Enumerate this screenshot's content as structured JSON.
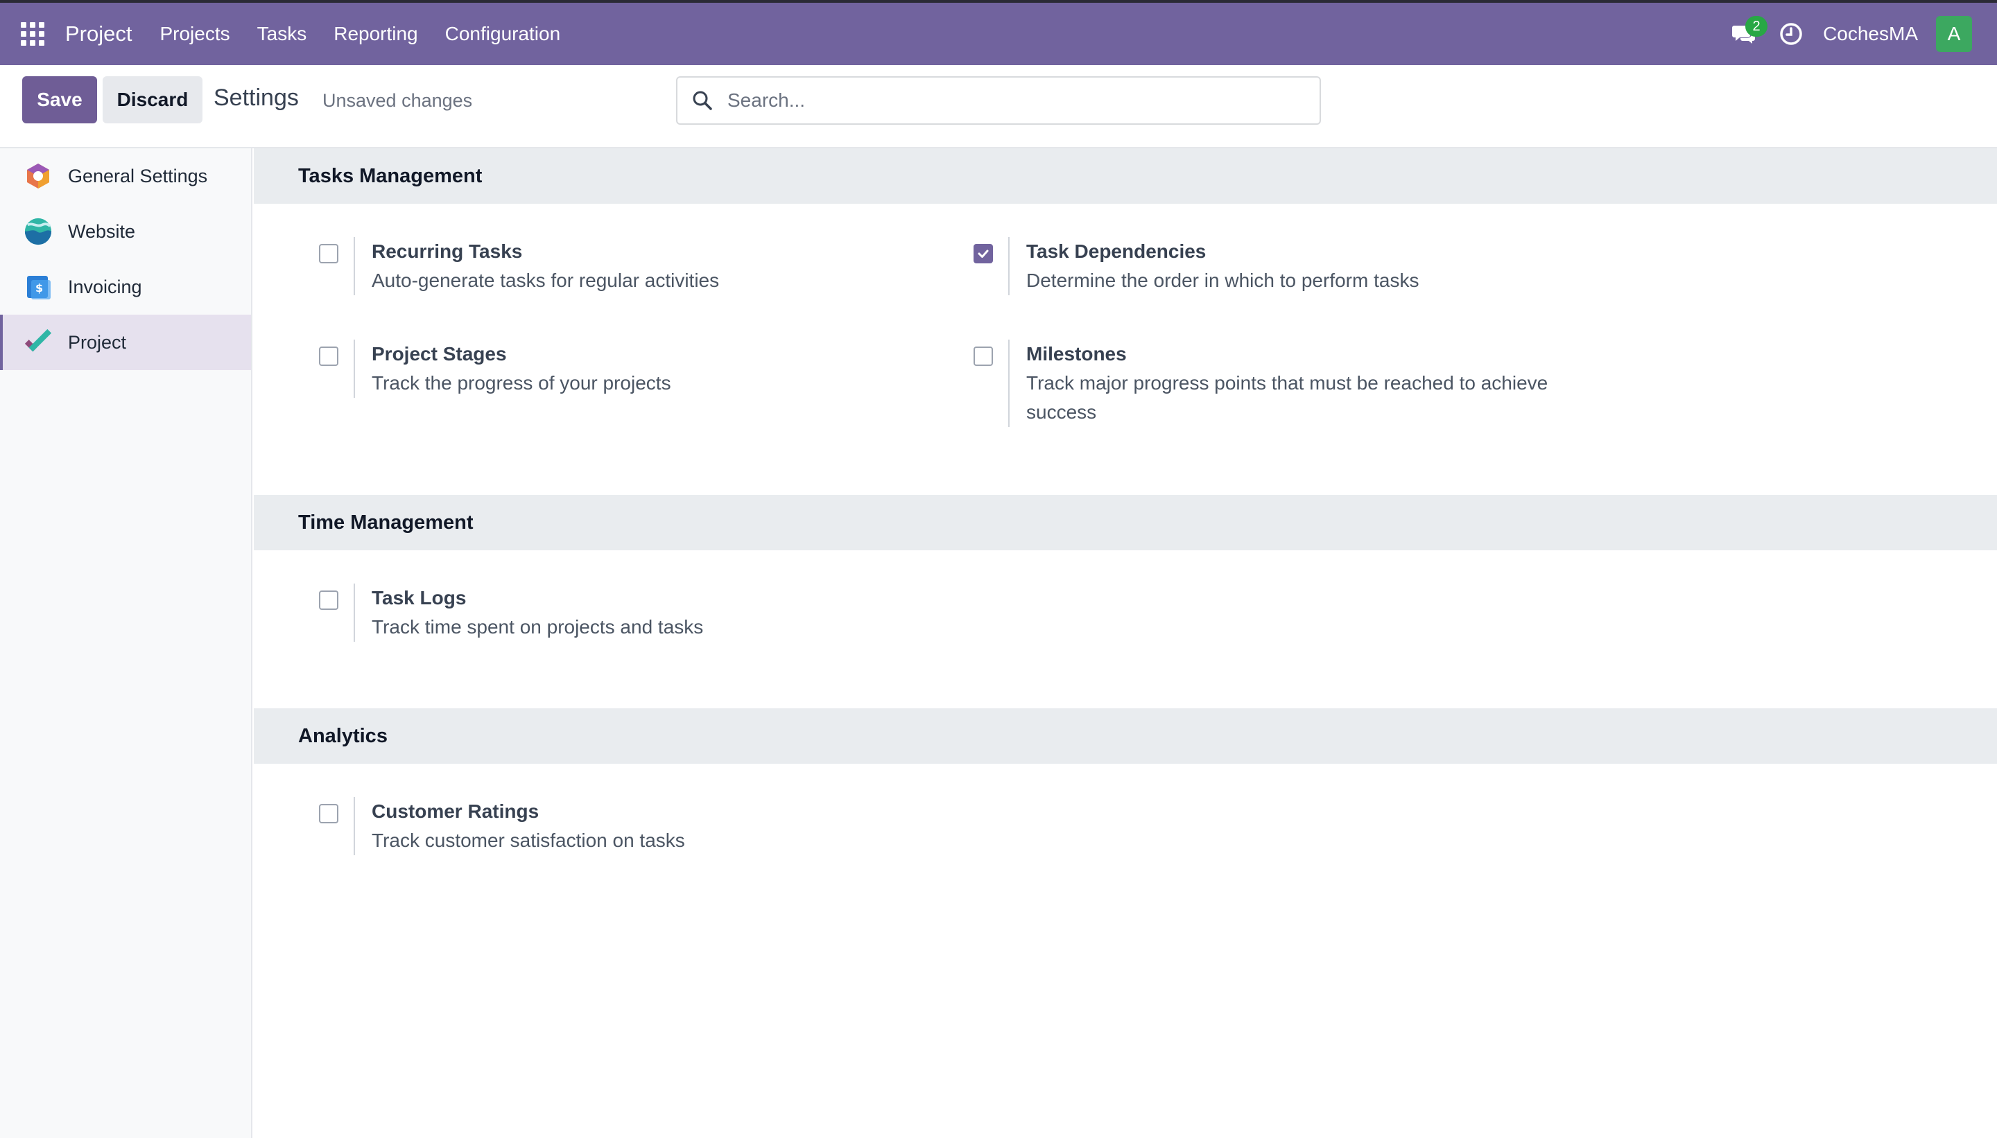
{
  "navbar": {
    "brand": "Project",
    "menu": [
      "Projects",
      "Tasks",
      "Reporting",
      "Configuration"
    ],
    "chat_badge": "2",
    "company": "CochesMA",
    "avatar_letter": "A",
    "color": "#71639e"
  },
  "control_panel": {
    "save_label": "Save",
    "discard_label": "Discard",
    "title": "Settings",
    "status": "Unsaved changes",
    "search_placeholder": "Search..."
  },
  "sidebar": {
    "items": [
      {
        "label": "General Settings",
        "icon": "general-settings-icon",
        "active": false
      },
      {
        "label": "Website",
        "icon": "website-icon",
        "active": false
      },
      {
        "label": "Invoicing",
        "icon": "invoicing-icon",
        "active": false
      },
      {
        "label": "Project",
        "icon": "project-icon",
        "active": true
      }
    ]
  },
  "sections": [
    {
      "title": "Tasks Management",
      "settings": [
        {
          "title": "Recurring Tasks",
          "description": "Auto-generate tasks for regular activities",
          "checked": false
        },
        {
          "title": "Task Dependencies",
          "description": "Determine the order in which to perform tasks",
          "checked": true
        },
        {
          "title": "Project Stages",
          "description": "Track the progress of your projects",
          "checked": false
        },
        {
          "title": "Milestones",
          "description_line1": "Track major progress points that must be reached to achieve",
          "description_line2": "success",
          "checked": false
        }
      ]
    },
    {
      "title": "Time Management",
      "settings": [
        {
          "title": "Task Logs",
          "description": "Track time spent on projects and tasks",
          "checked": false
        }
      ]
    },
    {
      "title": "Analytics",
      "settings": [
        {
          "title": "Customer Ratings",
          "description": "Track customer satisfaction on tasks",
          "checked": false
        }
      ]
    }
  ]
}
